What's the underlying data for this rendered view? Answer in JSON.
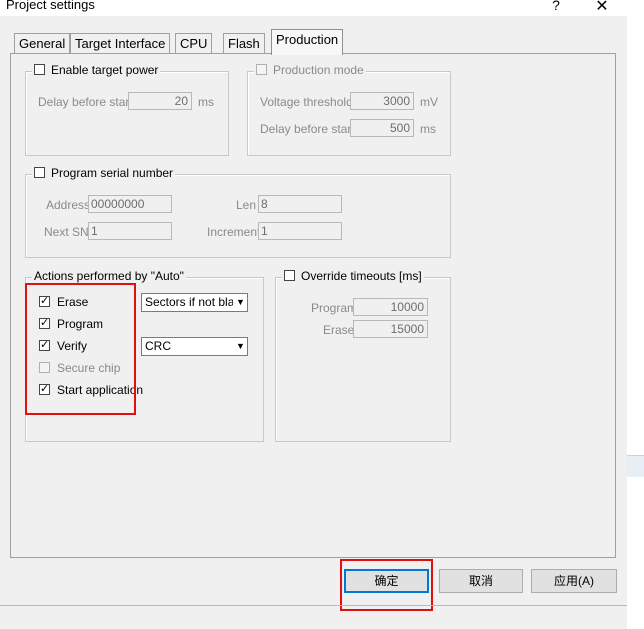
{
  "window": {
    "title": "Project settings",
    "help_glyph": "?",
    "close_glyph": "✕"
  },
  "tabs": [
    {
      "label": "General"
    },
    {
      "label": "Target Interface"
    },
    {
      "label": "CPU"
    },
    {
      "label": "Flash"
    },
    {
      "label": "Production"
    }
  ],
  "active_tab": "Production",
  "target_power": {
    "checkbox_label": "Enable target power",
    "checked": false,
    "delay_label": "Delay before start",
    "delay_value": "20",
    "delay_unit": "ms"
  },
  "production_mode": {
    "checkbox_label": "Production mode",
    "checked": false,
    "voltage_label": "Voltage threshold",
    "voltage_value": "3000",
    "voltage_unit": "mV",
    "delay_label": "Delay before start",
    "delay_value": "500",
    "delay_unit": "ms"
  },
  "serial_number": {
    "checkbox_label": "Program serial number",
    "checked": false,
    "address_label": "Address",
    "address_value": "00000000",
    "len_label": "Len",
    "len_value": "8",
    "next_sn_label": "Next SN",
    "next_sn_value": "1",
    "increment_label": "Increment",
    "increment_value": "1"
  },
  "actions": {
    "legend": "Actions performed by \"Auto\"",
    "items": [
      {
        "label": "Erase",
        "checked": true,
        "enabled": true
      },
      {
        "label": "Program",
        "checked": true,
        "enabled": true
      },
      {
        "label": "Verify",
        "checked": true,
        "enabled": true
      },
      {
        "label": "Secure chip",
        "checked": false,
        "enabled": false
      },
      {
        "label": "Start application",
        "checked": true,
        "enabled": true
      }
    ],
    "erase_mode": "Sectors if not blan",
    "verify_mode": "CRC"
  },
  "timeouts": {
    "checkbox_label": "Override timeouts [ms]",
    "checked": false,
    "program_label": "Program",
    "program_value": "10000",
    "erase_label": "Erase",
    "erase_value": "15000"
  },
  "buttons": {
    "ok": "确定",
    "cancel": "取消",
    "apply": "应用(A)"
  },
  "colors": {
    "highlight": "#e01010",
    "default_button_border": "#0078d7"
  }
}
